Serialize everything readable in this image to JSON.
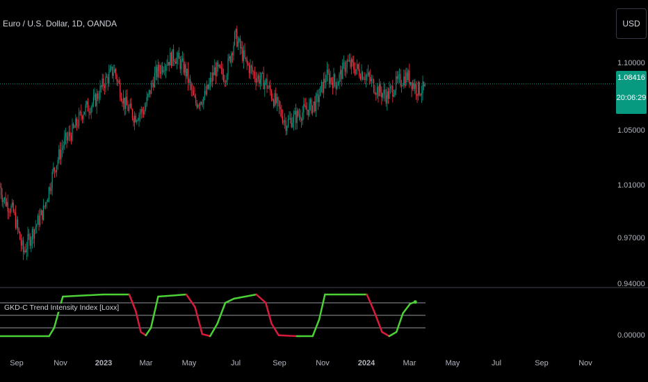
{
  "symbol": "Euro / U.S. Dollar, 1D, OANDA",
  "currency": "USD",
  "last_price": "1.08416",
  "countdown": "20:06:29",
  "indicator_name": "GKD-C Trend Intensity Index [Loxx]",
  "colors": {
    "background": "#000000",
    "up": "#089981",
    "down": "#f23645",
    "indicator_up": "#4cd137",
    "indicator_down": "#d81b3c",
    "grid_text": "#b2b5be"
  },
  "chart_data": [
    {
      "type": "candlestick",
      "title": "",
      "y_ticks": [
        "1.10000",
        "1.05000",
        "1.01000",
        "0.97000",
        "0.94000"
      ],
      "x_ticks": [
        "Sep",
        "Nov",
        "2023",
        "Mar",
        "May",
        "Jul",
        "Sep",
        "Nov",
        "2024",
        "Mar",
        "May",
        "Jul",
        "Sep",
        "Nov"
      ],
      "ylim": [
        0.935,
        1.145
      ],
      "last_price": 1.08416,
      "close_path": [
        [
          "2022-08-15",
          1.03
        ],
        [
          "2022-08-29",
          1.0
        ],
        [
          "2022-09-12",
          0.99
        ],
        [
          "2022-09-26",
          0.96
        ],
        [
          "2022-10-10",
          0.975
        ],
        [
          "2022-10-24",
          0.99
        ],
        [
          "2022-11-07",
          1.02
        ],
        [
          "2022-11-21",
          1.04
        ],
        [
          "2022-12-05",
          1.05
        ],
        [
          "2022-12-19",
          1.065
        ],
        [
          "2023-01-02",
          1.07
        ],
        [
          "2023-01-16",
          1.085
        ],
        [
          "2023-01-30",
          1.095
        ],
        [
          "2023-02-13",
          1.07
        ],
        [
          "2023-02-27",
          1.06
        ],
        [
          "2023-03-13",
          1.065
        ],
        [
          "2023-03-27",
          1.09
        ],
        [
          "2023-04-10",
          1.1
        ],
        [
          "2023-04-24",
          1.105
        ],
        [
          "2023-05-08",
          1.095
        ],
        [
          "2023-05-22",
          1.07
        ],
        [
          "2023-06-05",
          1.075
        ],
        [
          "2023-06-19",
          1.095
        ],
        [
          "2023-07-03",
          1.09
        ],
        [
          "2023-07-17",
          1.12
        ],
        [
          "2023-07-31",
          1.1
        ],
        [
          "2023-08-14",
          1.09
        ],
        [
          "2023-08-28",
          1.085
        ],
        [
          "2023-09-11",
          1.07
        ],
        [
          "2023-09-25",
          1.055
        ],
        [
          "2023-10-09",
          1.06
        ],
        [
          "2023-10-23",
          1.065
        ],
        [
          "2023-11-06",
          1.07
        ],
        [
          "2023-11-20",
          1.09
        ],
        [
          "2023-12-04",
          1.085
        ],
        [
          "2023-12-18",
          1.1
        ],
        [
          "2024-01-01",
          1.095
        ],
        [
          "2024-01-15",
          1.09
        ],
        [
          "2024-01-29",
          1.08
        ],
        [
          "2024-02-12",
          1.075
        ],
        [
          "2024-02-26",
          1.085
        ],
        [
          "2024-03-11",
          1.09
        ],
        [
          "2024-03-25",
          1.08
        ]
      ]
    },
    {
      "type": "line",
      "title": "GKD-C Trend Intensity Index [Loxx]",
      "y_ticks": [
        "0.00000"
      ],
      "levels": [
        80,
        50,
        20
      ],
      "ylim": [
        0,
        100
      ],
      "series": [
        {
          "values": [
            [
              "2022-08-15",
              0
            ],
            [
              "2022-11-01",
              0
            ],
            [
              "2022-11-08",
              20
            ],
            [
              "2022-11-20",
              95
            ],
            [
              "2023-01-15",
              100
            ],
            [
              "2023-02-20",
              100
            ],
            [
              "2023-03-01",
              60
            ],
            [
              "2023-03-08",
              10
            ],
            [
              "2023-03-15",
              2
            ],
            [
              "2023-03-22",
              20
            ],
            [
              "2023-04-01",
              95
            ],
            [
              "2023-05-10",
              100
            ],
            [
              "2023-05-22",
              70
            ],
            [
              "2023-06-01",
              5
            ],
            [
              "2023-06-12",
              0
            ],
            [
              "2023-06-22",
              30
            ],
            [
              "2023-07-03",
              80
            ],
            [
              "2023-07-15",
              90
            ],
            [
              "2023-08-15",
              100
            ],
            [
              "2023-08-28",
              80
            ],
            [
              "2023-09-05",
              30
            ],
            [
              "2023-09-15",
              2
            ],
            [
              "2023-10-10",
              0
            ],
            [
              "2023-11-01",
              0
            ],
            [
              "2023-11-10",
              40
            ],
            [
              "2023-11-18",
              100
            ],
            [
              "2024-01-15",
              100
            ],
            [
              "2024-01-25",
              60
            ],
            [
              "2024-02-05",
              10
            ],
            [
              "2024-02-15",
              0
            ],
            [
              "2024-02-25",
              10
            ],
            [
              "2024-03-05",
              55
            ],
            [
              "2024-03-15",
              78
            ],
            [
              "2024-03-22",
              82
            ]
          ]
        }
      ]
    }
  ]
}
